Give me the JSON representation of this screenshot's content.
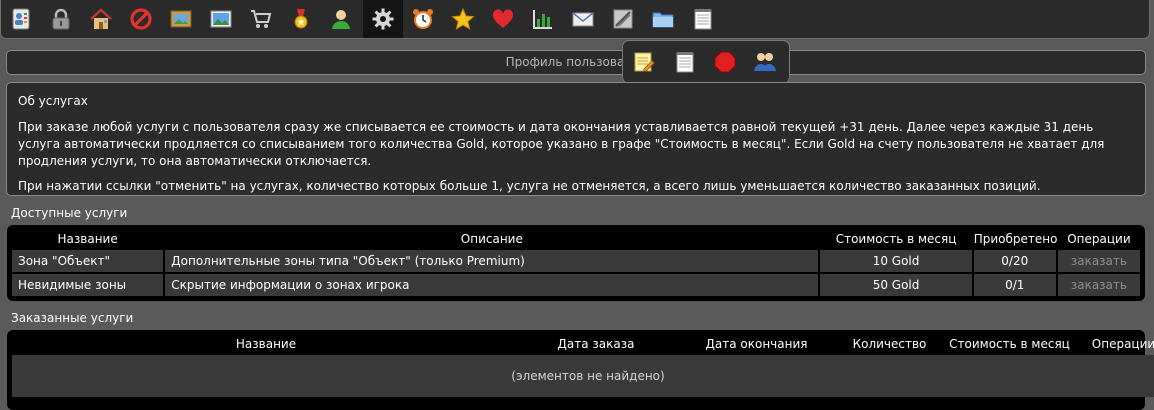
{
  "toolbar": {
    "icons": [
      "contacts-icon",
      "lock-icon",
      "home-icon",
      "forbidden-icon",
      "picture-frame-icon",
      "landscape-icon",
      "cart-icon",
      "medal-icon",
      "user-icon",
      "gear-icon",
      "alarm-clock-icon",
      "star-icon",
      "heart-icon",
      "bar-chart-icon",
      "mail-icon",
      "tools-icon",
      "folder-icon",
      "notepad-icon"
    ],
    "active": "gear-icon"
  },
  "profile_bar": {
    "label": "Профиль пользовател"
  },
  "popup": {
    "icons": [
      "edit-note-icon",
      "notepad-icon",
      "stop-icon",
      "users-icon"
    ]
  },
  "info": {
    "title": "Об услугах",
    "p1": "При заказе любой услуги с пользователя сразу же списывается ее стоимость и дата окончания уставливается равной текущей +31 день. Далее через каждые 31 день услуга автоматически продляется со списыванием того количества Gold, которое указано в графе \"Стоимость в месяц\". Если Gold на счету пользователя не хватает для продления услуги, то она автоматически отключается.",
    "p2": "При нажатии ссылки \"отменить\" на услугах, количество которых больше 1, услуга не отменяется, а всего лишь уменьшается количество заказанных позиций."
  },
  "available": {
    "label": "Доступные услуги",
    "headers": {
      "name": "Название",
      "desc": "Описание",
      "cost": "Стоимость в месяц",
      "bought": "Приобретено",
      "ops": "Операции"
    },
    "rows": [
      {
        "name": "Зона \"Объект\"",
        "desc": "Дополнительные зоны типа \"Объект\" (только Premium)",
        "cost": "10 Gold",
        "bought": "0/20",
        "op": "заказать"
      },
      {
        "name": "Невидимые зоны",
        "desc": "Скрытие информации о зонах игрока",
        "cost": "50 Gold",
        "bought": "0/1",
        "op": "заказать"
      }
    ]
  },
  "ordered": {
    "label": "Заказанные услуги",
    "headers": {
      "name": "Название",
      "date_order": "Дата заказа",
      "date_end": "Дата окончания",
      "qty": "Количество",
      "cost": "Стоимость в месяц",
      "ops": "Операции"
    },
    "empty": "(элементов не найдено)"
  }
}
